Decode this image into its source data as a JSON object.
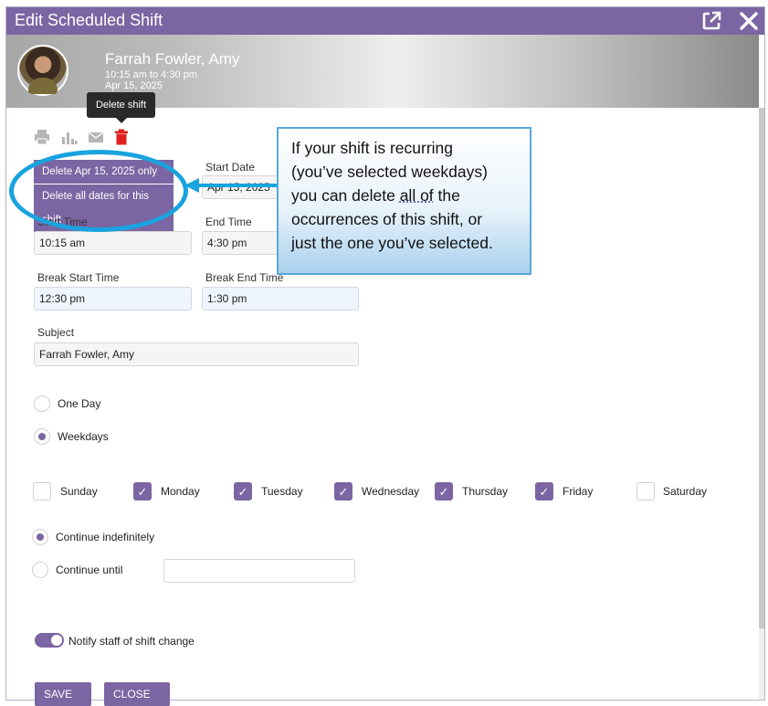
{
  "dialog": {
    "title": "Edit Scheduled Shift"
  },
  "employee": {
    "name": "Farrah Fowler, Amy",
    "time_range": "10:15 am to 4:30 pm",
    "date": "Apr 15, 2025"
  },
  "tooltip": "Delete shift",
  "toolbar": {
    "icons": [
      "print-icon",
      "chart-icon",
      "email-icon",
      "trash-icon"
    ]
  },
  "delete_menu": {
    "only_label": "Delete Apr 15, 2025 only",
    "all_label": "Delete all dates for this shift"
  },
  "form": {
    "start_date_label": "Start Date",
    "start_date": "Apr 15, 2025",
    "start_time_label": "Start Time",
    "start_time": "10:15 am",
    "end_time_label": "End Time",
    "end_time": "4:30 pm",
    "break_start_label": "Break Start Time",
    "break_start": "12:30 pm",
    "break_end_label": "Break End Time",
    "break_end": "1:30 pm",
    "subject_label": "Subject",
    "subject": "Farrah Fowler, Amy"
  },
  "recurrence": {
    "one_day": "One Day",
    "weekdays": "Weekdays",
    "selected": "Weekdays",
    "days": [
      {
        "label": "Sunday",
        "checked": false
      },
      {
        "label": "Monday",
        "checked": true
      },
      {
        "label": "Tuesday",
        "checked": true
      },
      {
        "label": "Wednesday",
        "checked": true
      },
      {
        "label": "Thursday",
        "checked": true
      },
      {
        "label": "Friday",
        "checked": true
      },
      {
        "label": "Saturday",
        "checked": false
      }
    ],
    "continue_indefinitely": "Continue indefinitely",
    "continue_until": "Continue until",
    "continue_until_value": "",
    "continue_selected": "Continue indefinitely"
  },
  "notify": {
    "label": "Notify staff of shift change",
    "on": true
  },
  "buttons": {
    "save": "SAVE",
    "close": "CLOSE"
  },
  "callout": {
    "line1": "If your shift is recurring",
    "line2": "(you’ve selected weekdays)",
    "line3a": "you can delete ",
    "line3b": "all of",
    "line3c": " the",
    "line4": "occurrences of this shift, or",
    "line5": "just the one you’ve selected."
  },
  "colors": {
    "accent": "#7b65a3",
    "callout_border": "#5aa9d6",
    "highlight_ring": "#19a3df",
    "delete_red": "#e0201e"
  }
}
